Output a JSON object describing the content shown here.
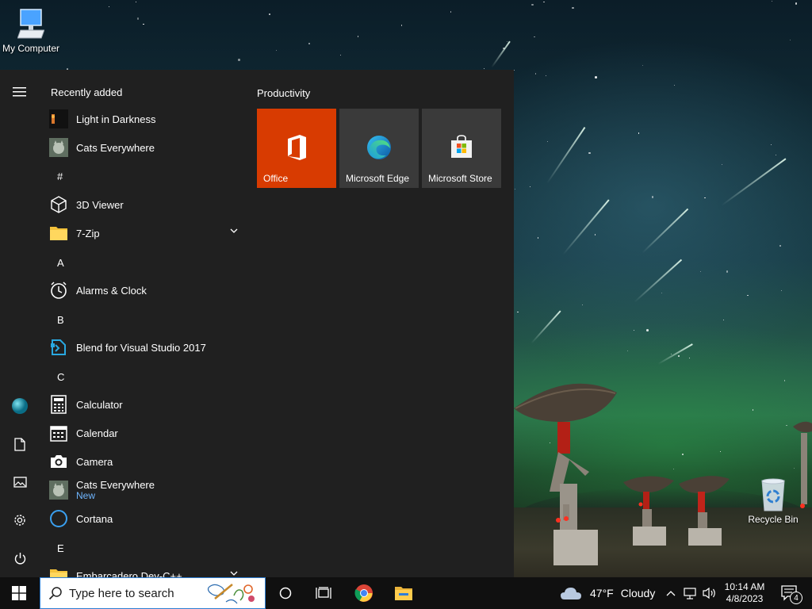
{
  "desktop": {
    "icons": [
      {
        "label": "My Computer",
        "icon": "computer-icon"
      },
      {
        "label": "Recycle Bin",
        "icon": "recycle-bin-icon"
      }
    ]
  },
  "start_menu": {
    "rail": {
      "items": [
        {
          "icon": "hamburger-menu-icon"
        },
        {
          "icon": "user-avatar-icon"
        },
        {
          "icon": "documents-icon"
        },
        {
          "icon": "pictures-icon"
        },
        {
          "icon": "settings-gear-icon"
        },
        {
          "icon": "power-icon"
        }
      ]
    },
    "app_list": {
      "recently_added_label": "Recently added",
      "recent": [
        {
          "name": "Light in Darkness",
          "icon": "light-in-darkness-icon"
        },
        {
          "name": "Cats Everywhere",
          "icon": "cats-everywhere-icon"
        }
      ],
      "sections": [
        {
          "letter": "#"
        },
        {
          "letter": "A"
        },
        {
          "letter": "B"
        },
        {
          "letter": "C"
        },
        {
          "letter": "E"
        }
      ],
      "apps": [
        {
          "name": "3D Viewer",
          "icon": "3d-viewer-icon"
        },
        {
          "name": "7-Zip",
          "icon": "folder-icon",
          "expandable": true
        },
        {
          "name": "Alarms & Clock",
          "icon": "alarm-clock-icon"
        },
        {
          "name": "Blend for Visual Studio 2017",
          "icon": "blend-icon"
        },
        {
          "name": "Calculator",
          "icon": "calculator-icon"
        },
        {
          "name": "Calendar",
          "icon": "calendar-icon"
        },
        {
          "name": "Camera",
          "icon": "camera-icon"
        },
        {
          "name": "Cats Everywhere",
          "sub": "New",
          "icon": "cats-everywhere-icon"
        },
        {
          "name": "Cortana",
          "icon": "cortana-icon"
        },
        {
          "name": "Embarcadero Dev-C++",
          "icon": "folder-icon",
          "expandable": true
        }
      ]
    },
    "tiles": {
      "group_title": "Productivity",
      "items": [
        {
          "label": "Office",
          "color": "#d83b01",
          "icon": "office-icon"
        },
        {
          "label": "Microsoft Edge",
          "color": "#3a3a3a",
          "icon": "edge-icon"
        },
        {
          "label": "Microsoft Store",
          "color": "#3a3a3a",
          "icon": "store-icon"
        }
      ]
    }
  },
  "taskbar": {
    "search_placeholder": "Type here to search",
    "pinned": [
      {
        "icon": "cortana-circle-icon"
      },
      {
        "icon": "task-view-icon"
      },
      {
        "icon": "chrome-icon"
      },
      {
        "icon": "file-explorer-icon"
      }
    ],
    "weather": {
      "temp": "47°F",
      "condition": "Cloudy"
    },
    "clock": {
      "time": "10:14 AM",
      "date": "4/8/2023"
    },
    "notifications_count": "4"
  }
}
